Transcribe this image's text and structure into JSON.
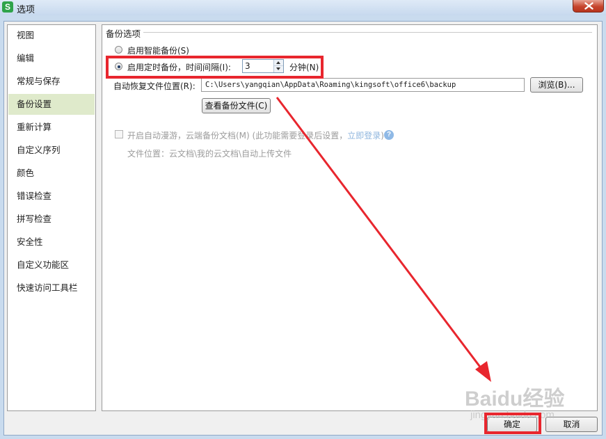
{
  "window": {
    "title": "选项",
    "app_icon_letter": "S"
  },
  "sidebar": {
    "items": [
      {
        "label": "视图"
      },
      {
        "label": "编辑"
      },
      {
        "label": "常规与保存"
      },
      {
        "label": "备份设置"
      },
      {
        "label": "重新计算"
      },
      {
        "label": "自定义序列"
      },
      {
        "label": "颜色"
      },
      {
        "label": "错误检查"
      },
      {
        "label": "拼写检查"
      },
      {
        "label": "安全性"
      },
      {
        "label": "自定义功能区"
      },
      {
        "label": "快速访问工具栏"
      }
    ],
    "selected_index": 3
  },
  "backup": {
    "group_title": "备份选项",
    "smart_backup_label": "启用智能备份(S)",
    "timed_backup_label": "启用定时备份，时间间隔(I):",
    "interval_value": "3",
    "minutes_label": "分钟(N)",
    "recovery_location_label": "自动恢复文件位置(R):",
    "recovery_path": "C:\\Users\\yangqian\\AppData\\Roaming\\kingsoft\\office6\\backup",
    "browse_label": "浏览(B)...",
    "view_backup_label": "查看备份文件(C)",
    "cloud_roaming_label": "开启自动漫游，云端备份文档(M) (此功能需要登录后设置，",
    "login_link": "立即登录",
    "cloud_roaming_suffix": ")",
    "file_location_text": "文件位置：云文档\\我的云文档\\自动上传文件"
  },
  "footer": {
    "ok_label": "确定",
    "cancel_label": "取消"
  },
  "watermark": {
    "logo": "Baidu经验",
    "url": "jingyan.baidu.com"
  },
  "colors": {
    "highlight_red": "#e8262e",
    "sidebar_selected": "#dfeacb",
    "link_disabled": "#8fb6de"
  },
  "icons": {
    "close": "close-icon",
    "help": "help-icon",
    "app": "wps-app-icon"
  }
}
